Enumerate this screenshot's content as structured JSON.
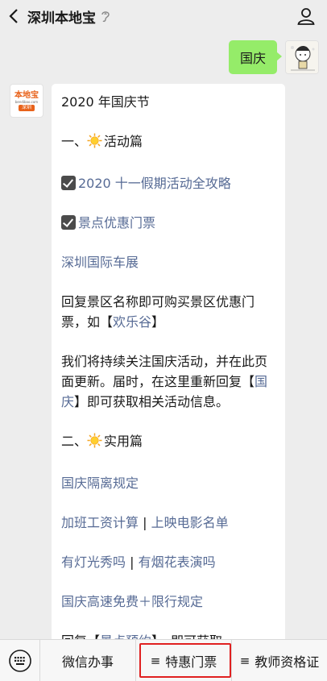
{
  "header": {
    "title": "深圳本地宝",
    "back_icon": "chevron-left-icon",
    "ear_icon": "ear-icon",
    "user_icon": "person-icon"
  },
  "outgoing": {
    "text": "国庆"
  },
  "bot_avatar": {
    "logo_text": "本地宝",
    "logo_url": "bendibao.com",
    "logo_city": "深圳"
  },
  "incoming": {
    "title": "2020 年国庆节",
    "section1": "一、",
    "section1_label": "活动篇",
    "link1": "2020 十一假期活动全攻略",
    "link2": "景点优惠门票",
    "link3": "深圳国际车展",
    "para1_before": "回复景区名称即可购买景区优惠门票，如【",
    "para1_link": "欢乐谷",
    "para1_after": "】",
    "para2_before": "我们将持续关注国庆活动，并在此页面更新。届时，在这里重新回复【",
    "para2_link": "国庆",
    "para2_after": "】即可获取相关活动信息。",
    "section2": "二、",
    "section2_label": "实用篇",
    "link4": "国庆隔离规定",
    "link5": "加班工资计算",
    "link6": "上映电影名单",
    "link7": "有灯光秀吗",
    "link8": "有烟花表演吗",
    "link9": "国庆高速免费＋限行规定",
    "partial_before": "回复【",
    "partial_link": "景点预约",
    "partial_after": "】，即可获取"
  },
  "bottom_menu": {
    "keyboard_icon": "keyboard-icon",
    "items": [
      {
        "label": "微信办事",
        "has_menu_icon": false
      },
      {
        "label": "特惠门票",
        "has_menu_icon": true
      },
      {
        "label": "教师资格证",
        "has_menu_icon": true
      }
    ],
    "menu_glyph": "≡",
    "highlight_color": "#e02020"
  },
  "colors": {
    "link": "#576b95",
    "bubble_out": "#95ec69",
    "background": "#ededed"
  }
}
